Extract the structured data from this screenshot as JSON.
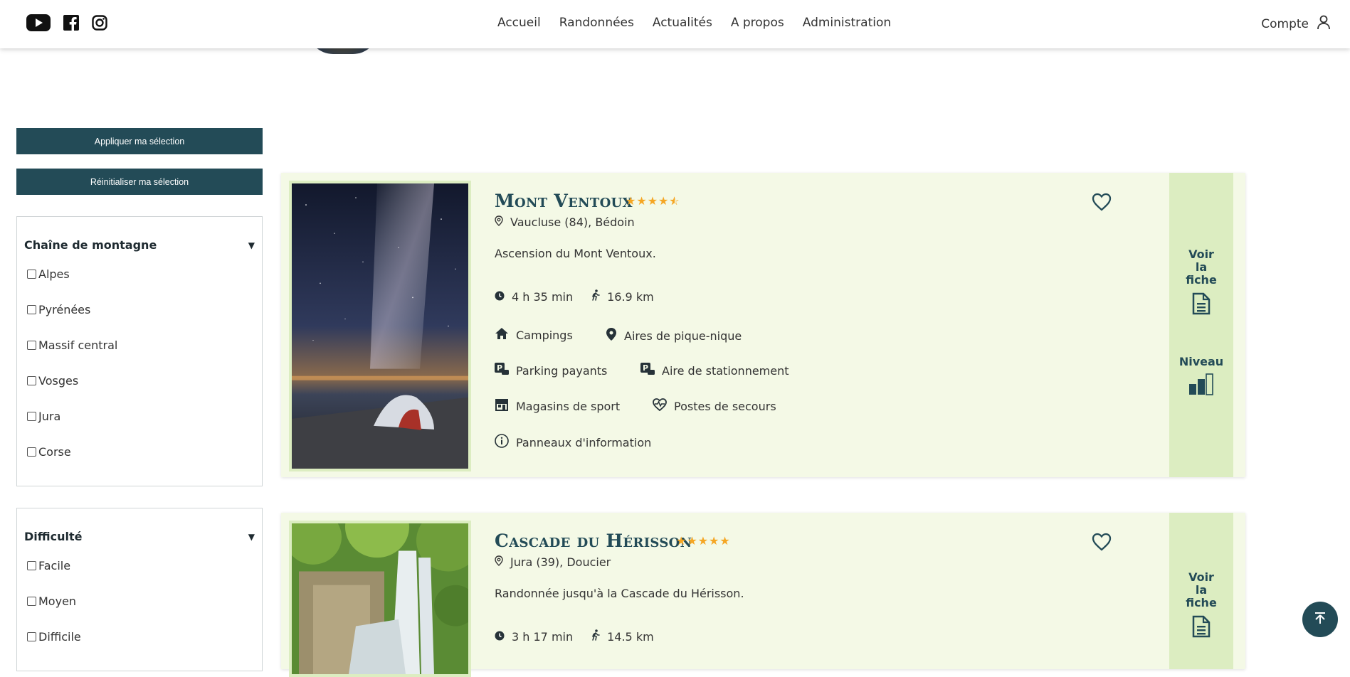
{
  "header": {
    "nav": [
      "Accueil",
      "Randonnées",
      "Actualités",
      "A propos",
      "Administration"
    ],
    "account_label": "Compte"
  },
  "sidebar": {
    "apply_label": "Appliquer ma sélection",
    "reset_label": "Réinitialiser ma sélection",
    "filters": [
      {
        "title": "Chaîne de montagne",
        "options": [
          "Alpes",
          "Pyrénées",
          "Massif central",
          "Vosges",
          "Jura",
          "Corse"
        ]
      },
      {
        "title": "Difficulté",
        "options": [
          "Facile",
          "Moyen",
          "Difficile"
        ]
      }
    ]
  },
  "hikes": [
    {
      "title": "Mont Ventoux",
      "rating": 4.5,
      "location": "Vaucluse (84), Bédoin",
      "description": "Ascension du Mont Ventoux.",
      "duration": "4 h 35 min",
      "distance": "16.9 km",
      "features": [
        "Campings",
        "Aires de pique-nique",
        "Parking payants",
        "Aire de stationnement",
        "Magasins de sport",
        "Postes de secours",
        "Panneaux d'information"
      ],
      "see_label": "Voir la fiche",
      "level_label": "Niveau",
      "level": 2
    },
    {
      "title": "Cascade du Hérisson",
      "rating": 5,
      "location": "Jura (39), Doucier",
      "description": "Randonnée jusqu'à la Cascade du Hérisson.",
      "duration": "3 h 17 min",
      "distance": "14.5 km",
      "see_label": "Voir la fiche"
    }
  ],
  "colors": {
    "primary": "#234b57",
    "card_bg": "#f4f9e6",
    "panel_bg": "#dcedc1",
    "star": "#f5a623"
  },
  "icons": [
    "youtube-icon",
    "facebook-icon",
    "instagram-icon",
    "user-icon",
    "location-icon",
    "clock-icon",
    "walk-icon",
    "house-icon",
    "map-pin-icon",
    "parking-icon",
    "shop-icon",
    "heart-pulse-icon",
    "info-icon",
    "heart-icon",
    "document-icon",
    "level-bars-icon",
    "arrow-up-icon"
  ]
}
